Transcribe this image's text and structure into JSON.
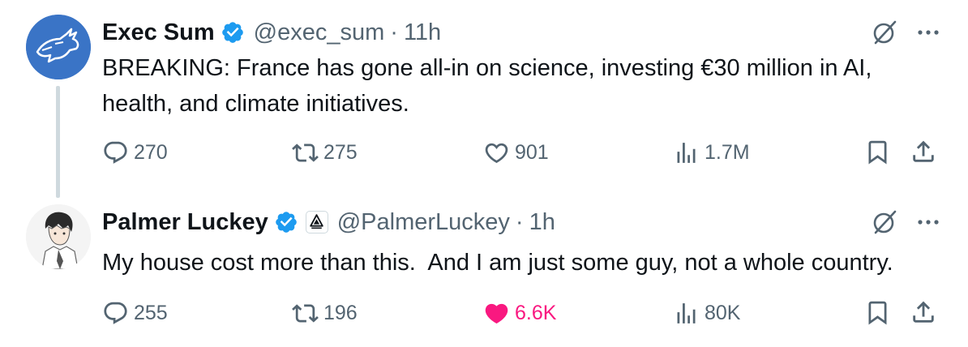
{
  "colors": {
    "text_primary": "#0f1419",
    "text_secondary": "#536471",
    "verified_blue": "#1d9bf0",
    "like_pink": "#f91880",
    "avatar_blue": "#3a74c6",
    "thread_line": "#cfd9de"
  },
  "tweets": [
    {
      "name": "Exec Sum",
      "handle": "@exec_sum",
      "separator": "·",
      "time": "11h",
      "text": "BREAKING: France has gone all-in on science, investing €30 million in AI, health, and climate initiatives.",
      "avatar_icon": "bull-logo-icon",
      "verified": true,
      "affiliation_badge": false,
      "stats": {
        "replies": "270",
        "retweets": "275",
        "likes": "901",
        "views": "1.7M"
      },
      "liked": false
    },
    {
      "name": "Palmer Luckey",
      "handle": "@PalmerLuckey",
      "separator": "·",
      "time": "1h",
      "text": "My house cost more than this.  And I am just some guy, not a whole country.",
      "avatar_icon": "anime-portrait-avatar",
      "verified": true,
      "affiliation_badge": true,
      "stats": {
        "replies": "255",
        "retweets": "196",
        "likes": "6.6K",
        "views": "80K"
      },
      "liked": true
    }
  ]
}
